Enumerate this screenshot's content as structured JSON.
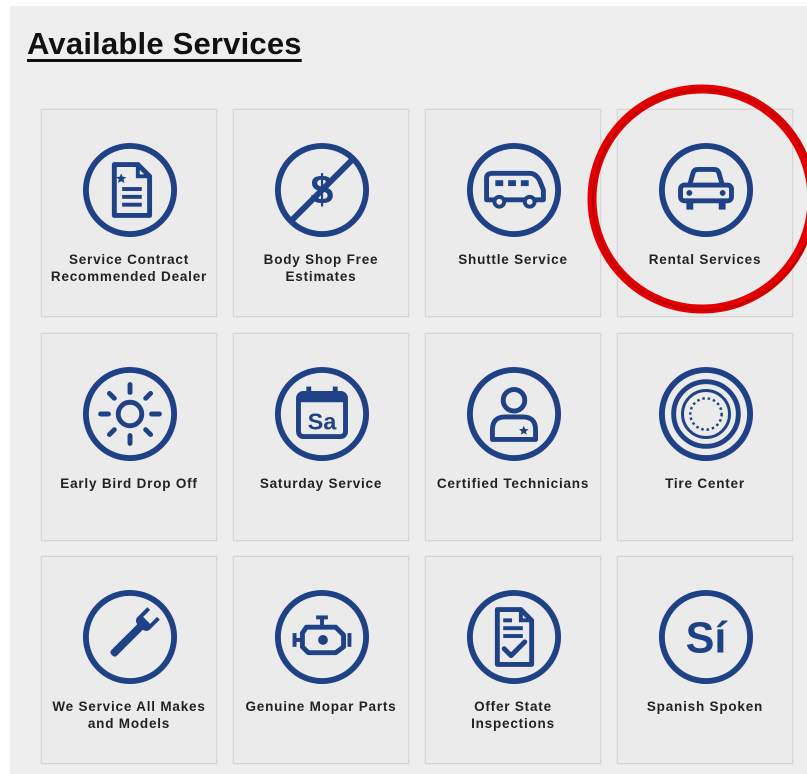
{
  "header": {
    "title": "Available Services"
  },
  "services": [
    {
      "label": "Service Contract Recommended Dealer",
      "icon": "document-icon"
    },
    {
      "label": "Body Shop Free Estimates",
      "icon": "no-dollar-icon"
    },
    {
      "label": "Shuttle Service",
      "icon": "shuttle-van-icon"
    },
    {
      "label": "Rental Services",
      "icon": "car-icon"
    },
    {
      "label": "Early Bird Drop Off",
      "icon": "sun-icon"
    },
    {
      "label": "Saturday Service",
      "icon": "calendar-saturday-icon"
    },
    {
      "label": "Certified Technicians",
      "icon": "technician-icon"
    },
    {
      "label": "Tire Center",
      "icon": "tire-icon"
    },
    {
      "label": "We Service All Makes and Models",
      "icon": "wrench-icon"
    },
    {
      "label": "Genuine Mopar Parts",
      "icon": "engine-icon"
    },
    {
      "label": "Offer State Inspections",
      "icon": "inspection-checklist-icon"
    },
    {
      "label": "Spanish Spoken",
      "icon": "si-icon"
    }
  ],
  "colors": {
    "icon": "#1f4186",
    "highlight": "#e30000",
    "tile_bg": "#ecebeb"
  }
}
